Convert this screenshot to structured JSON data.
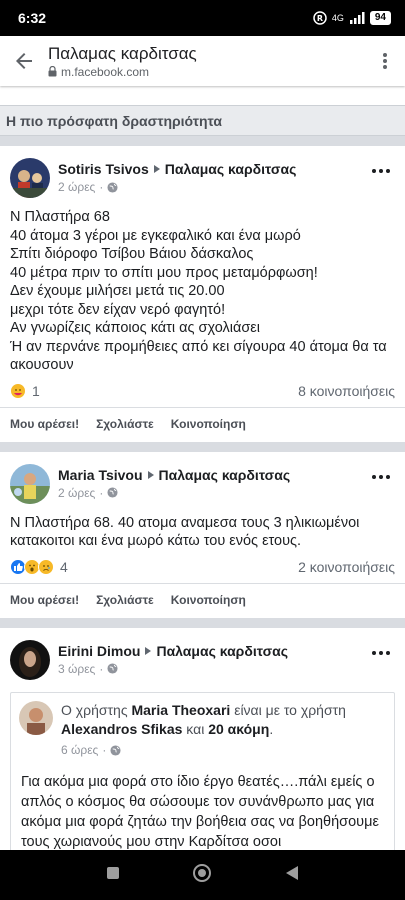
{
  "status_bar": {
    "time": "6:32",
    "network": "4G",
    "battery": "94"
  },
  "browser": {
    "page_title": "Παλαμας καρδιτσας",
    "url": "m.facebook.com"
  },
  "section_title": "Η πιο πρόσφατη δραστηριότητα",
  "posts": [
    {
      "author": "Sotiris Tsivos",
      "group": "Παλαμας καρδιτσας",
      "time": "2 ώρες",
      "lines": [
        "Ν Πλαστήρα 68",
        "40 άτομα 3 γέροι με εγκεφαλικό και ένα μωρό",
        "Σπίτι διόροφο Τσίβου Βάιου δάσκαλος",
        "40 μέτρα πριν το σπίτι μου προς μεταμόρφωση!",
        "Δεν έχουμε μιλήσει μετά τις 20.00",
        "μεχρι τότε δεν είχαν νερό φαγητό!",
        "Αν γνωρίζεις κάποιος κάτι ας σχολιάσει",
        "Ή αν περνάνε προμήθειες από κει σίγουρα 40 άτομα θα τα ακουσουν"
      ],
      "reaction_count": "1",
      "shares": "8 κοινοποιήσεις"
    },
    {
      "author": "Maria Tsivou",
      "group": "Παλαμας καρδιτσας",
      "time": "2 ώρες",
      "lines": [
        "Ν Πλαστήρα 68. 40 ατομα αναμεσα τους 3 ηλικιωμένοι κατακοιτοι και ένα μωρό κάτω του ενός ετους."
      ],
      "reaction_count": "4",
      "shares": "2 κοινοποιήσεις"
    },
    {
      "author": "Eirini Dimou",
      "group": "Παλαμας καρδιτσας",
      "time": "3 ώρες",
      "shared": {
        "prefix": "Ο χρήστης",
        "user": "Maria Theoxari",
        "middle": "είναι με το χρήστη",
        "with": "Alexandros Sfikas",
        "and": "και",
        "others": "20 ακόμη",
        "end": ".",
        "time": "6 ώρες",
        "text": "Για ακόμα μια φορά στο ίδιο έργο θεατές….πάλι εμείς ο απλός ο κόσμος θα σώσουμε τον συνάνθρωπο μας για ακόμα μια φορά ζητάω την βοήθεια σας να βοηθήσουμε τους χωριανούς μου στην Καρδίτσα οσοι"
      }
    }
  ],
  "actions": {
    "like": "Μου αρέσει!",
    "comment": "Σχολιάστε",
    "share": "Κοινοποίηση"
  },
  "colors": {
    "like_blue": "#1877f2",
    "text": "#1c1e21",
    "secondary": "#606770",
    "divider": "#d9dce1"
  }
}
